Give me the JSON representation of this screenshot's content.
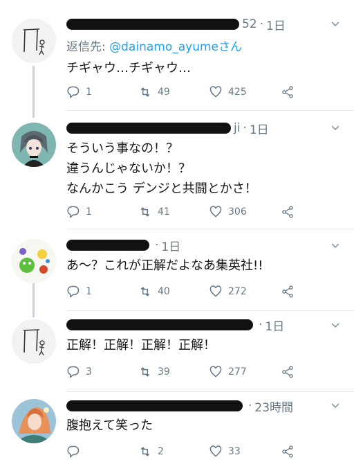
{
  "tweets": [
    {
      "time": "1日",
      "handle_tail": "52",
      "reply_prefix": "返信先: ",
      "reply_mention": "@dainamo_ayume",
      "reply_suffix": "さん",
      "text": "チギャウ…チギャウ…",
      "replies": "1",
      "retweets": "49",
      "likes": "425",
      "avatar": "stick-figure-drawing"
    },
    {
      "time": "1日",
      "handle_tail": "ji",
      "text": "そういう事なの！？\n違うんじゃないか！？\nなんかこう デンジと共闘とかさ！",
      "replies": "1",
      "retweets": "41",
      "likes": "306",
      "avatar": "anime-character"
    },
    {
      "time": "1日",
      "handle_tail": "",
      "text": "あ～？これが正解だよなあ集英社!!",
      "replies": "1",
      "retweets": "40",
      "likes": "272",
      "avatar": "colorful-creatures"
    },
    {
      "time": "1日",
      "handle_tail": "",
      "text": "正解！正解！正解！正解！",
      "replies": "3",
      "retweets": "39",
      "likes": "277",
      "avatar": "stick-figure-drawing"
    },
    {
      "time": "23時間",
      "handle_tail": "",
      "text": "腹抱えて笑った",
      "replies": "",
      "retweets": "2",
      "likes": "33",
      "avatar": "anime-girl-art"
    }
  ],
  "icons": {
    "reply": "reply-icon",
    "retweet": "retweet-icon",
    "like": "heart-icon",
    "share": "share-icon",
    "menu": "chevron-down-icon"
  },
  "colors": {
    "link": "#1da1f2",
    "muted": "#657786",
    "text": "#14171a",
    "divider": "#e6ecf0"
  }
}
